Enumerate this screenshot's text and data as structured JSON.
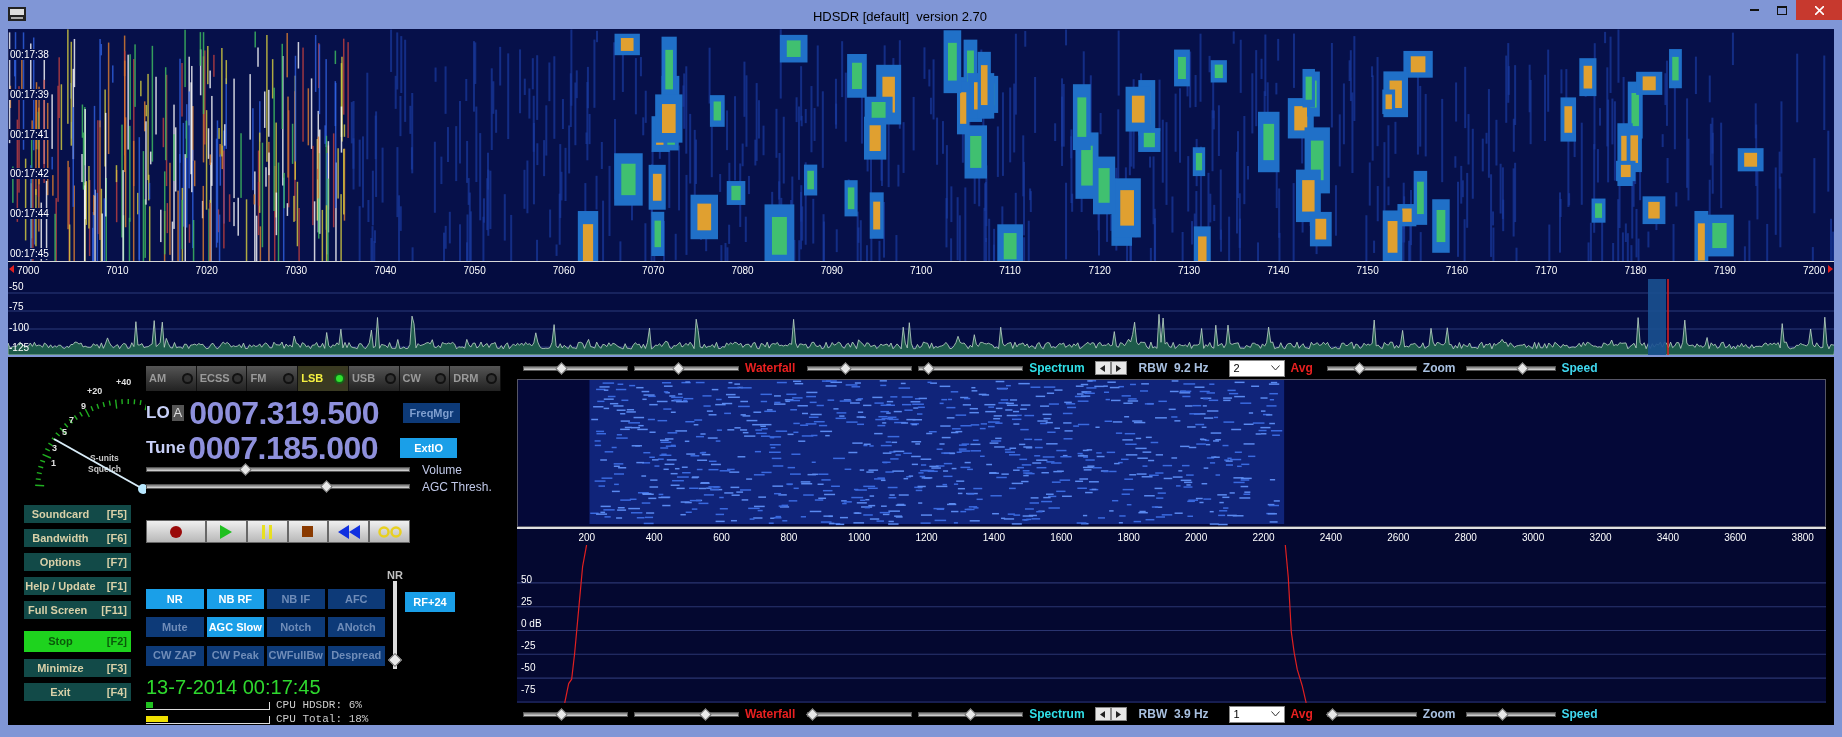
{
  "window": {
    "title": "HDSDR [default]  version 2.70"
  },
  "waterfall": {
    "time_labels": [
      "00:17:38",
      "00:17:39",
      "00:17:41",
      "00:17:42",
      "00:17:44",
      "00:17:45"
    ]
  },
  "frequency_axis": {
    "labels": [
      "7000",
      "7010",
      "7020",
      "7030",
      "7040",
      "7050",
      "7060",
      "7070",
      "7080",
      "7090",
      "7100",
      "7110",
      "7120",
      "7130",
      "7140",
      "7150",
      "7160",
      "7170",
      "7180",
      "7190",
      "7200"
    ]
  },
  "spectrum": {
    "db_labels": [
      "-50",
      "-75",
      "-100",
      "-125"
    ]
  },
  "smeter": {
    "scale_labels": [
      "+40",
      "+20",
      "9",
      "7",
      "5",
      "3",
      "1"
    ],
    "caption_lines": [
      "S-units",
      "Squelch"
    ]
  },
  "modes": [
    {
      "label": "AM",
      "selected": false
    },
    {
      "label": "ECSS",
      "selected": false
    },
    {
      "label": "FM",
      "selected": false
    },
    {
      "label": "LSB",
      "selected": true
    },
    {
      "label": "USB",
      "selected": false
    },
    {
      "label": "CW",
      "selected": false
    },
    {
      "label": "DRM",
      "selected": false
    }
  ],
  "lo": {
    "label": "LO",
    "vfo": "A",
    "frequency": "0007.319.500"
  },
  "tune": {
    "label": "Tune",
    "frequency": "0007.185.000"
  },
  "freq_buttons": [
    {
      "label": "FreqMgr",
      "on": false
    },
    {
      "label": "ExtIO",
      "on": true
    }
  ],
  "sliders": [
    {
      "label": "Volume",
      "level": 0.37
    },
    {
      "label": "AGC Thresh.",
      "level": 0.69
    }
  ],
  "transport": [
    {
      "kind": "record"
    },
    {
      "kind": "play"
    },
    {
      "kind": "pause"
    },
    {
      "kind": "stop"
    },
    {
      "kind": "rewind"
    },
    {
      "kind": "loop"
    }
  ],
  "function_buttons": [
    {
      "label": "Soundcard",
      "key": "[F5]",
      "active": false
    },
    {
      "label": "Bandwidth",
      "key": "[F6]",
      "active": false
    },
    {
      "label": "Options",
      "key": "[F7]",
      "active": false
    },
    {
      "label": "Help / Update",
      "key": "[F1]",
      "active": false
    },
    {
      "label": "Full Screen",
      "key": "[F11]",
      "active": false
    },
    {
      "label": "Stop",
      "key": "[F2]",
      "active": true
    },
    {
      "label": "Minimize",
      "key": "[F3]",
      "active": false
    },
    {
      "label": "Exit",
      "key": "[F4]",
      "active": false
    }
  ],
  "dsp_buttons": [
    {
      "label": "NR",
      "on": true
    },
    {
      "label": "NB RF",
      "on": true
    },
    {
      "label": "NB IF",
      "on": false
    },
    {
      "label": "AFC",
      "on": false
    },
    {
      "label": "Mute",
      "on": false
    },
    {
      "label": "AGC Slow",
      "on": true
    },
    {
      "label": "Notch",
      "on": false
    },
    {
      "label": "ANotch",
      "on": false
    },
    {
      "label": "CW ZAP",
      "on": false
    },
    {
      "label": "CW Peak",
      "on": false
    },
    {
      "label": "CWFullBw",
      "on": false
    },
    {
      "label": "Despread",
      "on": false
    }
  ],
  "nr_slider": {
    "label": "NR",
    "level": 0.1
  },
  "rf_button": {
    "label": "RF+24",
    "on": true
  },
  "datetime": "13-7-2014 00:17:45",
  "cpu": [
    {
      "label": "CPU HDSDR:",
      "value": "6%",
      "level": 0.06
    },
    {
      "label": "CPU Total:",
      "value": "18%",
      "level": 0.18
    }
  ],
  "top_controls": {
    "waterfall_sliders": [
      {
        "level": 0.35
      },
      {
        "level": 0.42
      }
    ],
    "waterfall_label": "Waterfall",
    "spectrum_sliders": [
      {
        "level": 0.35
      },
      {
        "level": 0.05
      }
    ],
    "spectrum_label": "Spectrum",
    "rbw": "RBW  9.2 Hz",
    "avg_value": "2",
    "avg_label": "Avg",
    "zoom_slider": {
      "level": 0.35
    },
    "zoom_label": "Zoom",
    "speed_slider": {
      "level": 0.65
    },
    "speed_label": "Speed"
  },
  "audio_axis": {
    "labels": [
      "200",
      "400",
      "600",
      "800",
      "1000",
      "1200",
      "1400",
      "1600",
      "1800",
      "2000",
      "2200",
      "2400",
      "2600",
      "2800",
      "3000",
      "3200",
      "3400",
      "3600",
      "3800"
    ]
  },
  "audio_spectrum": {
    "db_labels": [
      "50",
      "25",
      "0 dB",
      "-25",
      "-50",
      "-75"
    ]
  },
  "bottom_controls": {
    "waterfall_sliders": [
      {
        "level": 0.35
      },
      {
        "level": 0.7
      }
    ],
    "waterfall_label": "Waterfall",
    "spectrum_sliders": [
      {
        "level": 0.0
      },
      {
        "level": 0.5
      }
    ],
    "spectrum_label": "Spectrum",
    "rbw": "RBW  3.9 Hz",
    "avg_value": "1",
    "avg_label": "Avg",
    "zoom_slider": {
      "level": 0.0
    },
    "zoom_label": "Zoom",
    "speed_slider": {
      "level": 0.4
    },
    "speed_label": "Speed"
  }
}
